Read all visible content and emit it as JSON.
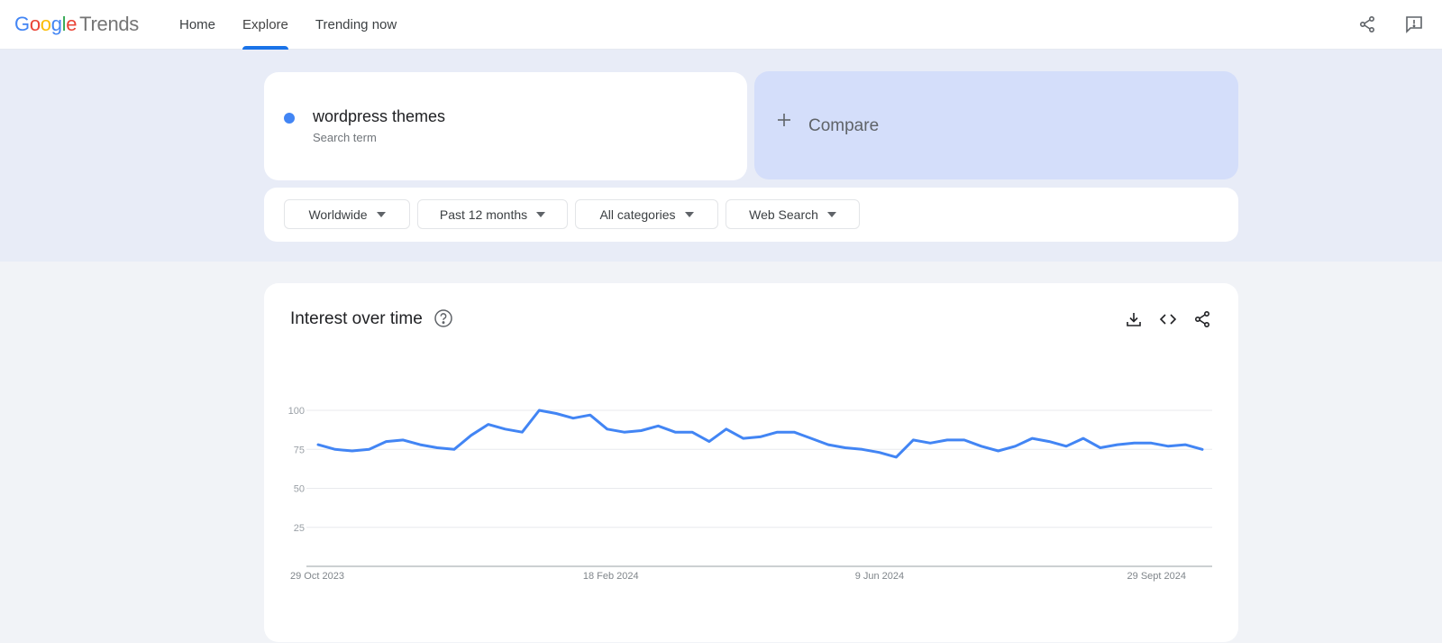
{
  "app": {
    "logo_google": [
      "G",
      "o",
      "o",
      "g",
      "l",
      "e"
    ],
    "logo_product": "Trends"
  },
  "nav": {
    "items": [
      {
        "label": "Home",
        "active": false
      },
      {
        "label": "Explore",
        "active": true
      },
      {
        "label": "Trending now",
        "active": false
      }
    ]
  },
  "top_icons": [
    "share-icon",
    "feedback-icon"
  ],
  "search": {
    "term": "wordpress themes",
    "term_type": "Search term",
    "term_color": "#4285f4",
    "compare_label": "Compare"
  },
  "filters": {
    "region": "Worldwide",
    "time_range": "Past 12 months",
    "category": "All categories",
    "search_type": "Web Search"
  },
  "chart_card": {
    "title": "Interest over time",
    "actions": [
      "download-icon",
      "embed-icon",
      "share-icon"
    ]
  },
  "chart_data": {
    "type": "line",
    "title": "Interest over time",
    "xlabel": "",
    "ylabel": "",
    "ylim": [
      0,
      100
    ],
    "yticks": [
      25,
      50,
      75,
      100
    ],
    "x_tick_labels": [
      "29 Oct 2023",
      "18 Feb 2024",
      "9 Jun 2024",
      "29 Sept 2024"
    ],
    "x_tick_indices": [
      0,
      16,
      32,
      48
    ],
    "grid": true,
    "legend": "none",
    "series": [
      {
        "name": "wordpress themes",
        "color": "#4285f4",
        "values": [
          78,
          75,
          74,
          75,
          80,
          81,
          78,
          76,
          75,
          84,
          91,
          88,
          86,
          100,
          98,
          95,
          97,
          88,
          86,
          87,
          90,
          86,
          86,
          80,
          88,
          82,
          83,
          86,
          86,
          82,
          78,
          76,
          75,
          73,
          70,
          81,
          79,
          81,
          81,
          77,
          74,
          77,
          82,
          80,
          77,
          82,
          76,
          78,
          79,
          79,
          77,
          78,
          75
        ]
      }
    ]
  }
}
